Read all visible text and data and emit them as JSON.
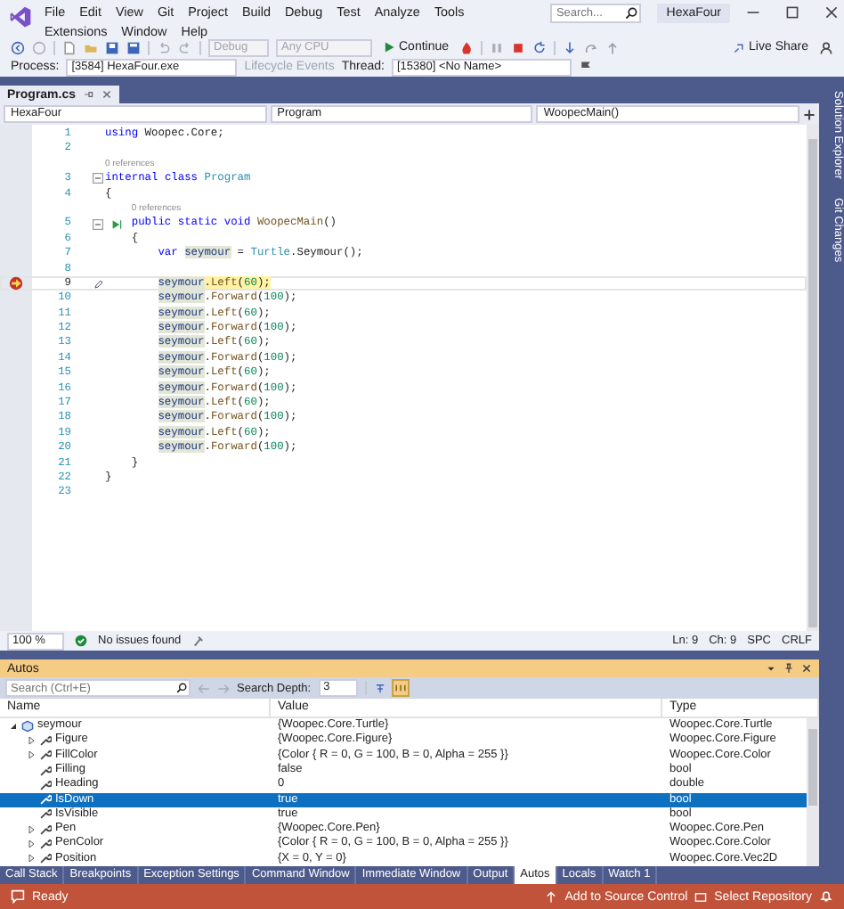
{
  "menu": {
    "items": [
      "File",
      "Edit",
      "View",
      "Git",
      "Project",
      "Build",
      "Debug",
      "Test",
      "Analyze",
      "Tools",
      "Extensions",
      "Window",
      "Help"
    ],
    "search": {
      "placeholder": "Search..."
    },
    "solution_name": "HexaFour"
  },
  "toolbar": {
    "configuration": {
      "value": "Debug",
      "disabled": true
    },
    "platform": {
      "value": "Any CPU",
      "disabled": true
    },
    "continue_label": "Continue",
    "live_share": "Live Share"
  },
  "debug_location": {
    "process_label": "Process:",
    "process": "[3584] HexaFour.exe",
    "lifecycle": {
      "label": "Lifecycle Events",
      "disabled": true
    },
    "thread_label": "Thread:",
    "thread": "[15380] <No Name>"
  },
  "document_tabs": [
    {
      "label": "Program.cs",
      "selected": true
    }
  ],
  "navigation": {
    "project": "HexaFour",
    "type": "Program",
    "member": "WoopecMain()"
  },
  "code": {
    "lines": [
      {
        "kind": "code",
        "number": "1",
        "current": false,
        "breakpoint": false,
        "collapsible": false,
        "run_marker": false,
        "tokens": [
          {
            "text": "using",
            "kind": "kw"
          },
          {
            "text": " Woopec.Core;",
            "kind": "plain"
          }
        ]
      },
      {
        "kind": "code",
        "number": "2",
        "current": false,
        "breakpoint": false,
        "collapsible": false,
        "run_marker": false
      },
      {
        "kind": "lens",
        "text": "0 references"
      },
      {
        "kind": "code",
        "number": "3",
        "current": false,
        "breakpoint": false,
        "collapsible": true,
        "run_marker": false,
        "tokens": [
          {
            "text": "internal",
            "kind": "kw"
          },
          {
            "text": " class",
            "kind": "kw"
          },
          {
            "text": " Program",
            "kind": "type"
          }
        ]
      },
      {
        "kind": "code",
        "number": "4",
        "current": false,
        "breakpoint": false,
        "collapsible": false,
        "run_marker": false,
        "tokens": [
          {
            "text": "{",
            "kind": "plain"
          }
        ]
      },
      {
        "kind": "lens",
        "text": "0 references"
      },
      {
        "kind": "code",
        "number": "5",
        "current": false,
        "breakpoint": false,
        "collapsible": true,
        "run_marker": true,
        "tokens": [
          {
            "text": "    public",
            "kind": "kw"
          },
          {
            "text": " static",
            "kind": "kw"
          },
          {
            "text": " void",
            "kind": "kw"
          },
          {
            "text": " WoopecMain",
            "kind": "method"
          },
          {
            "text": "()",
            "kind": "plain"
          }
        ]
      },
      {
        "kind": "code",
        "number": "6",
        "current": false,
        "breakpoint": false,
        "collapsible": false,
        "run_marker": false,
        "tokens": [
          {
            "text": "    {",
            "kind": "plain"
          }
        ]
      },
      {
        "kind": "code",
        "number": "7",
        "current": false,
        "breakpoint": false,
        "collapsible": false,
        "run_marker": false,
        "tokens": [
          {
            "text": "        var",
            "kind": "kw"
          },
          {
            "text": " seymour",
            "kind": "ref"
          },
          {
            "text": " =",
            "kind": "plain"
          },
          {
            "text": " Turtle",
            "kind": "type"
          },
          {
            "text": ".Seymour();",
            "kind": "plain"
          }
        ]
      },
      {
        "kind": "code",
        "number": "8",
        "current": false,
        "breakpoint": false,
        "collapsible": false,
        "run_marker": false
      },
      {
        "kind": "code",
        "number": "9",
        "current": true,
        "breakpoint": true,
        "collapsible": false,
        "run_marker": false,
        "tokens": [
          {
            "text": "        seymour",
            "kind": "ref"
          },
          {
            "text": ".",
            "kind": "plain"
          },
          {
            "text": "Left",
            "kind": "method"
          },
          {
            "text": "(",
            "kind": "plain"
          },
          {
            "text": "60",
            "kind": "num"
          },
          {
            "text": ");",
            "kind": "plain"
          }
        ]
      },
      {
        "kind": "code",
        "number": "10",
        "current": false,
        "breakpoint": false,
        "collapsible": false,
        "run_marker": false,
        "tokens": [
          {
            "text": "        seymour",
            "kind": "ref"
          },
          {
            "text": ".",
            "kind": "plain"
          },
          {
            "text": "Forward",
            "kind": "method"
          },
          {
            "text": "(",
            "kind": "plain"
          },
          {
            "text": "100",
            "kind": "num"
          },
          {
            "text": ");",
            "kind": "plain"
          }
        ]
      },
      {
        "kind": "code",
        "number": "11",
        "current": false,
        "breakpoint": false,
        "collapsible": false,
        "run_marker": false,
        "tokens": [
          {
            "text": "        seymour",
            "kind": "ref"
          },
          {
            "text": ".",
            "kind": "plain"
          },
          {
            "text": "Left",
            "kind": "method"
          },
          {
            "text": "(",
            "kind": "plain"
          },
          {
            "text": "60",
            "kind": "num"
          },
          {
            "text": ");",
            "kind": "plain"
          }
        ]
      },
      {
        "kind": "code",
        "number": "12",
        "current": false,
        "breakpoint": false,
        "collapsible": false,
        "run_marker": false,
        "tokens": [
          {
            "text": "        seymour",
            "kind": "ref"
          },
          {
            "text": ".",
            "kind": "plain"
          },
          {
            "text": "Forward",
            "kind": "method"
          },
          {
            "text": "(",
            "kind": "plain"
          },
          {
            "text": "100",
            "kind": "num"
          },
          {
            "text": ");",
            "kind": "plain"
          }
        ]
      },
      {
        "kind": "code",
        "number": "13",
        "current": false,
        "breakpoint": false,
        "collapsible": false,
        "run_marker": false,
        "tokens": [
          {
            "text": "        seymour",
            "kind": "ref"
          },
          {
            "text": ".",
            "kind": "plain"
          },
          {
            "text": "Left",
            "kind": "method"
          },
          {
            "text": "(",
            "kind": "plain"
          },
          {
            "text": "60",
            "kind": "num"
          },
          {
            "text": ");",
            "kind": "plain"
          }
        ]
      },
      {
        "kind": "code",
        "number": "14",
        "current": false,
        "breakpoint": false,
        "collapsible": false,
        "run_marker": false,
        "tokens": [
          {
            "text": "        seymour",
            "kind": "ref"
          },
          {
            "text": ".",
            "kind": "plain"
          },
          {
            "text": "Forward",
            "kind": "method"
          },
          {
            "text": "(",
            "kind": "plain"
          },
          {
            "text": "100",
            "kind": "num"
          },
          {
            "text": ");",
            "kind": "plain"
          }
        ]
      },
      {
        "kind": "code",
        "number": "15",
        "current": false,
        "breakpoint": false,
        "collapsible": false,
        "run_marker": false,
        "tokens": [
          {
            "text": "        seymour",
            "kind": "ref"
          },
          {
            "text": ".",
            "kind": "plain"
          },
          {
            "text": "Left",
            "kind": "method"
          },
          {
            "text": "(",
            "kind": "plain"
          },
          {
            "text": "60",
            "kind": "num"
          },
          {
            "text": ");",
            "kind": "plain"
          }
        ]
      },
      {
        "kind": "code",
        "number": "16",
        "current": false,
        "breakpoint": false,
        "collapsible": false,
        "run_marker": false,
        "tokens": [
          {
            "text": "        seymour",
            "kind": "ref"
          },
          {
            "text": ".",
            "kind": "plain"
          },
          {
            "text": "Forward",
            "kind": "method"
          },
          {
            "text": "(",
            "kind": "plain"
          },
          {
            "text": "100",
            "kind": "num"
          },
          {
            "text": ");",
            "kind": "plain"
          }
        ]
      },
      {
        "kind": "code",
        "number": "17",
        "current": false,
        "breakpoint": false,
        "collapsible": false,
        "run_marker": false,
        "tokens": [
          {
            "text": "        seymour",
            "kind": "ref"
          },
          {
            "text": ".",
            "kind": "plain"
          },
          {
            "text": "Left",
            "kind": "method"
          },
          {
            "text": "(",
            "kind": "plain"
          },
          {
            "text": "60",
            "kind": "num"
          },
          {
            "text": ");",
            "kind": "plain"
          }
        ]
      },
      {
        "kind": "code",
        "number": "18",
        "current": false,
        "breakpoint": false,
        "collapsible": false,
        "run_marker": false,
        "tokens": [
          {
            "text": "        seymour",
            "kind": "ref"
          },
          {
            "text": ".",
            "kind": "plain"
          },
          {
            "text": "Forward",
            "kind": "method"
          },
          {
            "text": "(",
            "kind": "plain"
          },
          {
            "text": "100",
            "kind": "num"
          },
          {
            "text": ");",
            "kind": "plain"
          }
        ]
      },
      {
        "kind": "code",
        "number": "19",
        "current": false,
        "breakpoint": false,
        "collapsible": false,
        "run_marker": false,
        "tokens": [
          {
            "text": "        seymour",
            "kind": "ref"
          },
          {
            "text": ".",
            "kind": "plain"
          },
          {
            "text": "Left",
            "kind": "method"
          },
          {
            "text": "(",
            "kind": "plain"
          },
          {
            "text": "60",
            "kind": "num"
          },
          {
            "text": ");",
            "kind": "plain"
          }
        ]
      },
      {
        "kind": "code",
        "number": "20",
        "current": false,
        "breakpoint": false,
        "collapsible": false,
        "run_marker": false,
        "tokens": [
          {
            "text": "        seymour",
            "kind": "ref"
          },
          {
            "text": ".",
            "kind": "plain"
          },
          {
            "text": "Forward",
            "kind": "method"
          },
          {
            "text": "(",
            "kind": "plain"
          },
          {
            "text": "100",
            "kind": "num"
          },
          {
            "text": ");",
            "kind": "plain"
          }
        ]
      },
      {
        "kind": "code",
        "number": "21",
        "current": false,
        "breakpoint": false,
        "collapsible": false,
        "run_marker": false,
        "tokens": [
          {
            "text": "    }",
            "kind": "plain"
          }
        ]
      },
      {
        "kind": "code",
        "number": "22",
        "current": false,
        "breakpoint": false,
        "collapsible": false,
        "run_marker": false,
        "tokens": [
          {
            "text": "}",
            "kind": "plain"
          }
        ]
      },
      {
        "kind": "code",
        "number": "23",
        "current": false,
        "breakpoint": false,
        "collapsible": false,
        "run_marker": false
      }
    ]
  },
  "editor_status": {
    "zoom": "100 %",
    "issues": "No issues found",
    "line": "Ln: 9",
    "column": "Ch: 9",
    "whitespace": "SPC",
    "line_ending": "CRLF"
  },
  "side_tabs": [
    "Solution Explorer",
    "Git Changes"
  ],
  "autos": {
    "title": "Autos",
    "search": {
      "placeholder": "Search (Ctrl+E)"
    },
    "depth_label": "Search Depth:",
    "depth": "3",
    "columns": [
      "Name",
      "Value",
      "Type"
    ],
    "rows": [
      {
        "name": "seymour",
        "kind": "object",
        "value": "{Woopec.Core.Turtle}",
        "type": "Woopec.Core.Turtle",
        "expanded": true,
        "selected": false,
        "children": [
          {
            "name": "Figure",
            "kind": "property",
            "value": "{Woopec.Core.Figure}",
            "type": "Woopec.Core.Figure",
            "expanded": false,
            "selected": false
          },
          {
            "name": "FillColor",
            "kind": "property",
            "value": "{Color { R = 0, G = 100, B = 0, Alpha = 255 }}",
            "type": "Woopec.Core.Color",
            "expanded": false,
            "selected": false
          },
          {
            "name": "Filling",
            "kind": "property",
            "value": "false",
            "type": "bool",
            "selected": false
          },
          {
            "name": "Heading",
            "kind": "property",
            "value": "0",
            "type": "double",
            "selected": false
          },
          {
            "name": "IsDown",
            "kind": "property",
            "value": "true",
            "type": "bool",
            "selected": true
          },
          {
            "name": "IsVisible",
            "kind": "property",
            "value": "true",
            "type": "bool",
            "selected": false
          },
          {
            "name": "Pen",
            "kind": "property",
            "value": "{Woopec.Core.Pen}",
            "type": "Woopec.Core.Pen",
            "expanded": false,
            "selected": false
          },
          {
            "name": "PenColor",
            "kind": "property",
            "value": "{Color { R = 0, G = 100, B = 0, Alpha = 255 }}",
            "type": "Woopec.Core.Color",
            "expanded": false,
            "selected": false
          },
          {
            "name": "Position",
            "kind": "property",
            "value": "{X = 0, Y = 0}",
            "type": "Woopec.Core.Vec2D",
            "expanded": false,
            "selected": false
          }
        ]
      }
    ]
  },
  "tool_tabs": [
    {
      "label": "Call Stack",
      "selected": false
    },
    {
      "label": "Breakpoints",
      "selected": false
    },
    {
      "label": "Exception Settings",
      "selected": false
    },
    {
      "label": "Command Window",
      "selected": false
    },
    {
      "label": "Immediate Window",
      "selected": false
    },
    {
      "label": "Output",
      "selected": false
    },
    {
      "label": "Autos",
      "selected": true
    },
    {
      "label": "Locals",
      "selected": false
    },
    {
      "label": "Watch 1",
      "selected": false
    }
  ],
  "status_bar": {
    "state": "Ready",
    "source_control": "Add to Source Control",
    "repository": "Select Repository"
  }
}
